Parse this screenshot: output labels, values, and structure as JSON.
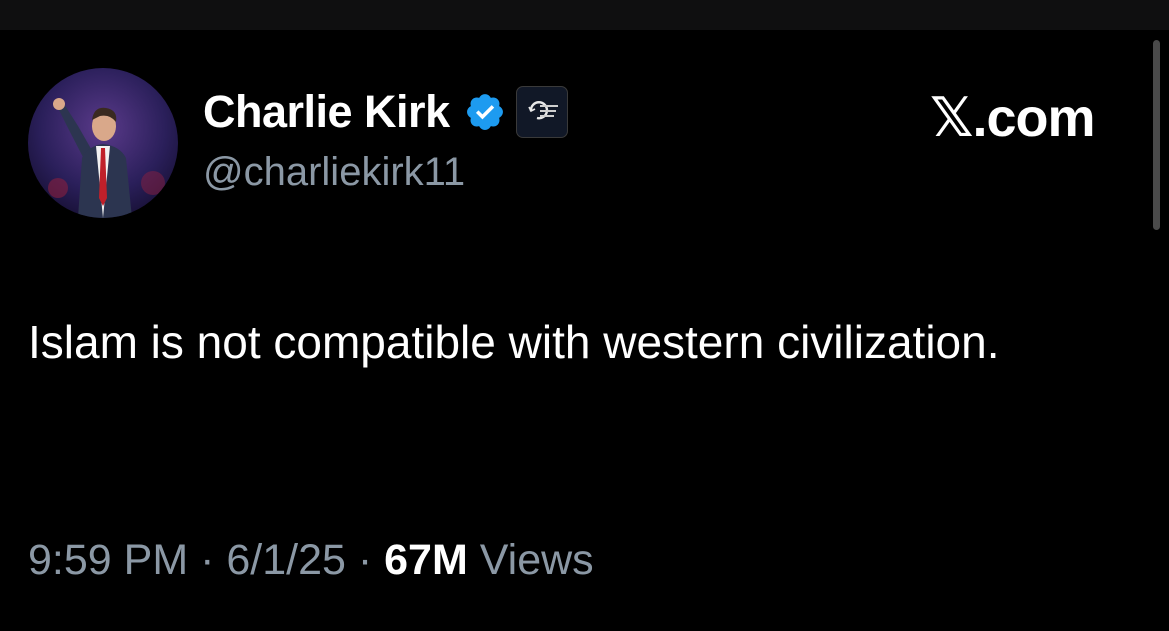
{
  "window": {
    "site_label": "𝕏.com"
  },
  "author": {
    "display_name": "Charlie Kirk",
    "handle": "@charliekirk11",
    "verified_icon": "verified-badge-icon",
    "affiliate_icon": "turning-point-usa-logo",
    "affiliate_text": "TURNING POINT USA"
  },
  "tweet": {
    "text": "Islam is not compatible with western civilization."
  },
  "meta": {
    "time": "9:59 PM",
    "sep1": " · ",
    "date": "6/1/25",
    "sep2": " · ",
    "views_count": "67M",
    "views_label": " Views"
  },
  "colors": {
    "background": "#000000",
    "text_primary": "#ffffff",
    "text_secondary": "#8b98a5",
    "verified_blue": "#1d9bf0"
  }
}
